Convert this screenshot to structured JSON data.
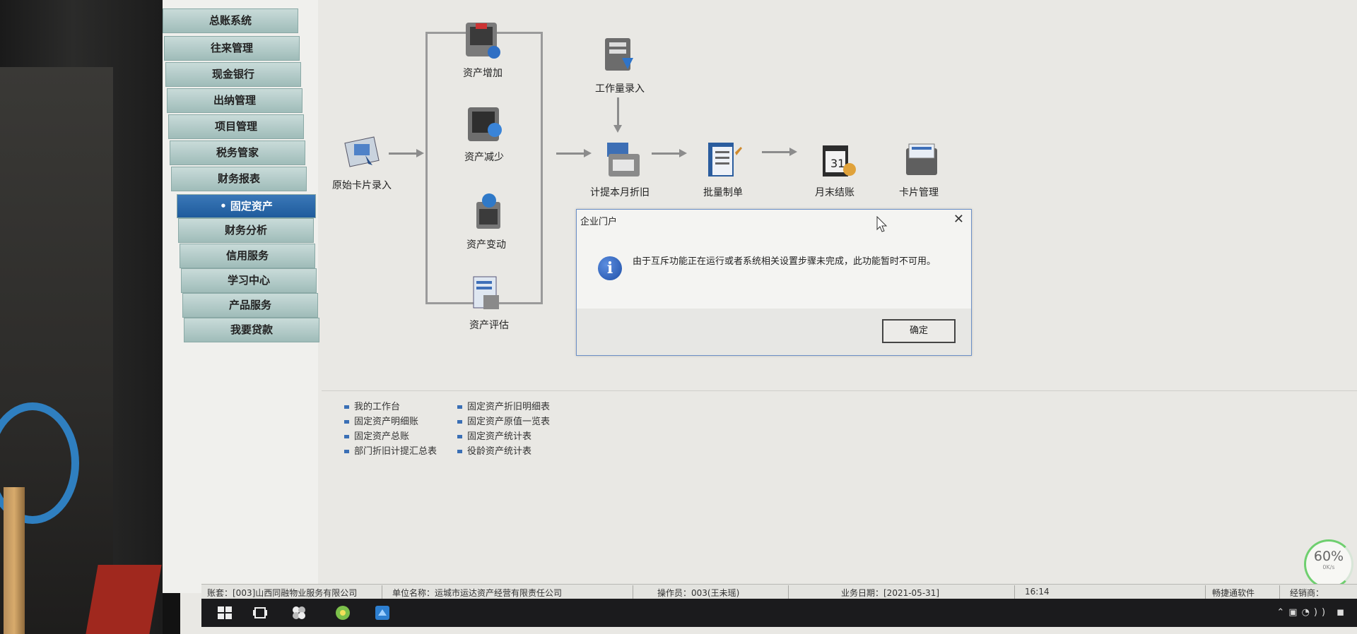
{
  "sidebar": {
    "items": [
      {
        "label": "总账系统"
      },
      {
        "label": "往来管理"
      },
      {
        "label": "现金银行"
      },
      {
        "label": "出纳管理"
      },
      {
        "label": "项目管理"
      },
      {
        "label": "税务管家"
      },
      {
        "label": "财务报表"
      },
      {
        "label": "固定资产",
        "active": true
      },
      {
        "label": "财务分析"
      },
      {
        "label": "信用服务"
      },
      {
        "label": "学习中心"
      },
      {
        "label": "产品服务"
      },
      {
        "label": "我要贷款"
      }
    ]
  },
  "flow": {
    "card_entry": "原始卡片录入",
    "asset_increase": "资产增加",
    "asset_decrease": "资产减少",
    "asset_change": "资产变动",
    "asset_evaluate": "资产评估",
    "workload_entry": "工作量录入",
    "depreciation": "计提本月折旧",
    "batch_voucher": "批量制单",
    "month_close": "月末结账",
    "card_manage": "卡片管理"
  },
  "dialog": {
    "title": "企业门户",
    "message": "由于互斥功能正在运行或者系统相关设置步骤未完成，此功能暂时不可用。",
    "ok_label": "确定",
    "close_glyph": "✕",
    "info_glyph": "i"
  },
  "links": {
    "col1": [
      "我的工作台",
      "固定资产明细账",
      "固定资产总账",
      "部门折旧计提汇总表"
    ],
    "col2": [
      "固定资产折旧明细表",
      "固定资产原值一览表",
      "固定资产统计表",
      "役龄资产统计表"
    ]
  },
  "status": {
    "account": "账套：[003]山西同融物业服务有限公司",
    "unit": "单位名称：运城市运达资产经营有限责任公司",
    "operator": "操作员：003(王未瑶)",
    "date": "业务日期：[2021-05-31]",
    "time": "16:14",
    "vendor": "畅捷通软件",
    "hotline": "经销商："
  },
  "gauge": {
    "value": "60%",
    "sub": "0K/s"
  },
  "colors": {
    "accent": "#1f5b9c",
    "sidebar_button": "#9fbcb9",
    "dialog_border": "#6b8fc7"
  }
}
